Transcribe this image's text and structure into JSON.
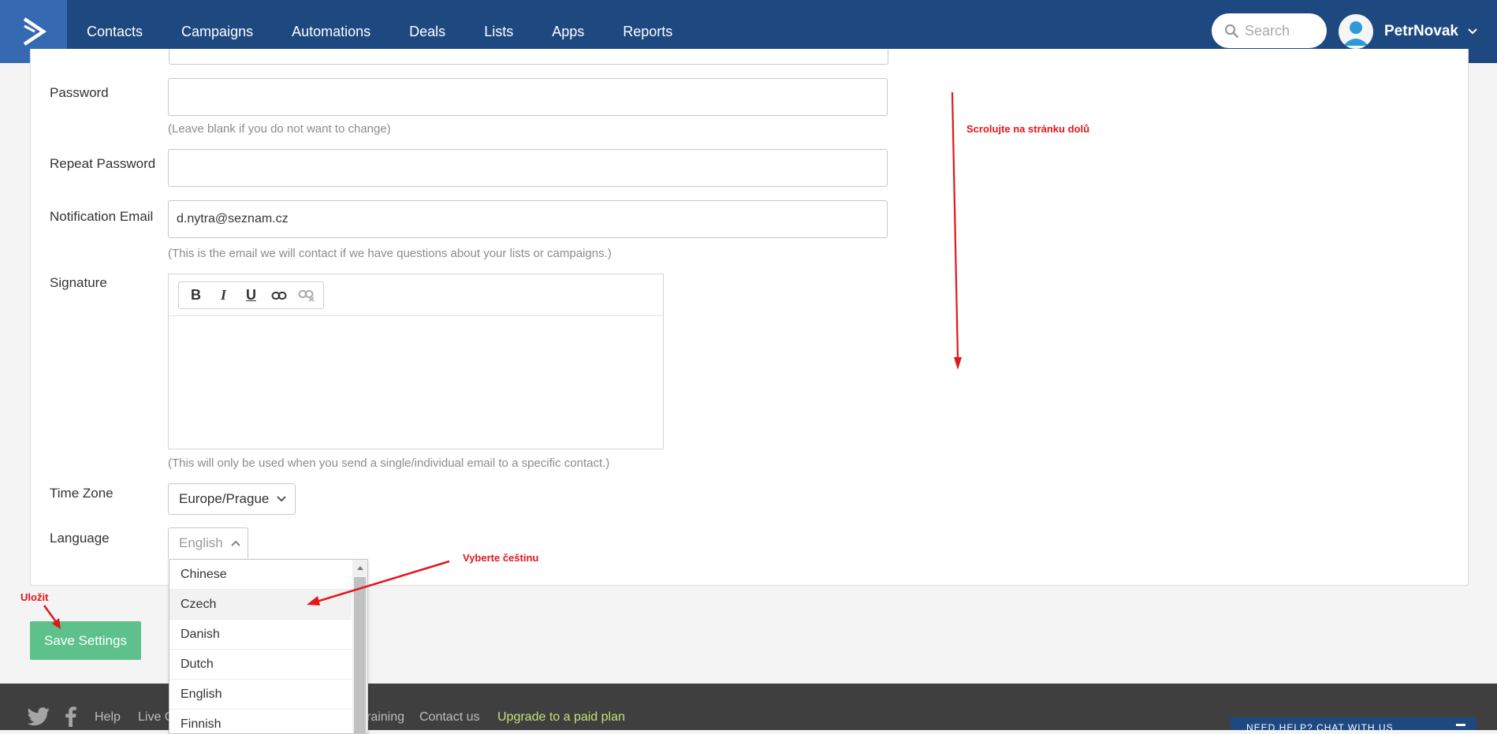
{
  "nav": {
    "items": [
      "Contacts",
      "Campaigns",
      "Automations",
      "Deals",
      "Lists",
      "Apps",
      "Reports"
    ],
    "search_placeholder": "Search",
    "username": "PetrNovak"
  },
  "form": {
    "password_label": "Password",
    "password_help": "(Leave blank if you do not want to change)",
    "repeat_password_label": "Repeat Password",
    "notification_email_label": "Notification Email",
    "notification_email_value": "d.nytra@seznam.cz",
    "notification_email_help": "(This is the email we will contact if we have questions about your lists or campaigns.)",
    "signature_label": "Signature",
    "signature_help": "(This will only be used when you send a single/individual email to a specific contact.)",
    "timezone_label": "Time Zone",
    "timezone_value": "Europe/Prague",
    "language_label": "Language",
    "language_value": "English",
    "language_options": [
      "Chinese",
      "Czech",
      "Danish",
      "Dutch",
      "English",
      "Finnish"
    ],
    "save_label": "Save Settings"
  },
  "footer": {
    "links": [
      "Help",
      "Live C",
      "raining",
      "Contact us",
      "Upgrade to a paid plan"
    ],
    "chat_text": "NEED HELP? CHAT WITH US"
  },
  "annotations": {
    "scroll": "Scrolujte na stránku dolů",
    "choose": "Vyberte češtinu",
    "save": "Uložit",
    "color": "#e3161a"
  },
  "colors": {
    "nav_bg": "#1d4880",
    "logo_bg": "#356ab3",
    "save_btn": "#5ec18b",
    "footer_bg": "#3f3f3f",
    "upgrade_link": "#c8e07a"
  }
}
